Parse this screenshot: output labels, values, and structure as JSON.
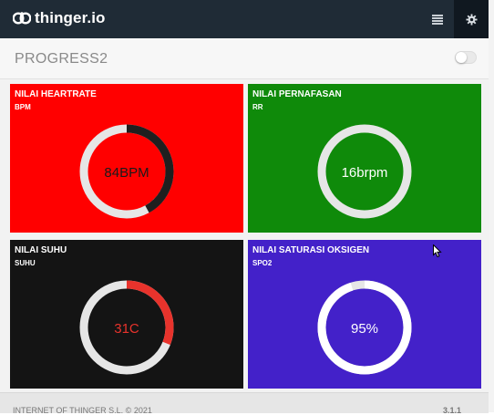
{
  "app": {
    "brand": "thinger.io"
  },
  "topbar": {
    "menu_icon": "list-icon",
    "settings_icon": "gear-icon"
  },
  "dashboard": {
    "title": "PROGRESS2",
    "toggle_on": false
  },
  "widgets": [
    {
      "title": "NILAI HEARTRATE",
      "subtitle": "BPM",
      "value_text": "84BPM",
      "fill_fraction": 0.42,
      "bg": "#ff0000",
      "ring_color": "#1f1f1f",
      "track_color": "#e6e6e6",
      "text_color": "#1a1a1a"
    },
    {
      "title": "NILAI PERNAFASAN",
      "subtitle": "RR",
      "value_text": "16brpm",
      "fill_fraction": 0.0,
      "bg": "#0f8a0a",
      "ring_color": "#ffffff",
      "track_color": "#e6e6e6",
      "text_color": "#ffffff"
    },
    {
      "title": "NILAI SUHU",
      "subtitle": "SUHU",
      "value_text": "31C",
      "fill_fraction": 0.31,
      "bg": "#141414",
      "ring_color": "#e8332c",
      "track_color": "#e6e6e6",
      "text_color": "#e8332c"
    },
    {
      "title": "NILAI SATURASI OKSIGEN",
      "subtitle": "SPO2",
      "value_text": "95%",
      "fill_fraction": 0.95,
      "bg": "#4321c9",
      "ring_color": "#ffffff",
      "track_color": "#e6e6e6",
      "text_color": "#ffffff"
    }
  ],
  "footer": {
    "left": "INTERNET OF THINGER S.L. © 2021",
    "right": "3.1.1"
  }
}
